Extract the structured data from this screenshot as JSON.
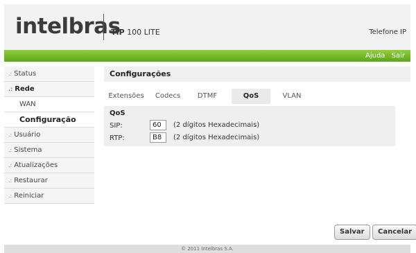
{
  "header": {
    "logo": "intelbras",
    "product_bold": "TIP",
    "product_rest": " 100 LITE",
    "right_label": "Telefone IP"
  },
  "top_links": [
    "Ajuda",
    "Sair"
  ],
  "sidebar": {
    "items": [
      {
        "label": "Status"
      },
      {
        "label": "Rede"
      },
      {
        "label": "WAN"
      },
      {
        "label": "Configuração"
      },
      {
        "label": "Usuário"
      },
      {
        "label": "Sistema"
      },
      {
        "label": "Atualizações"
      },
      {
        "label": "Restaurar"
      },
      {
        "label": "Reiniciar"
      }
    ],
    "bullet": ".:"
  },
  "content": {
    "title": "Configurações",
    "tabs": [
      "Extensões",
      "Codecs",
      "DTMF",
      "QoS",
      "VLAN"
    ],
    "active_tab": "QoS",
    "panel": {
      "title": "QoS",
      "sip_label": "SIP:",
      "sip_value": "60",
      "sip_hint": "(2 dígitos Hexadecimais)",
      "rtp_label": "RTP:",
      "rtp_value": "B8",
      "rtp_hint": "(2 dígitos Hexadecimais)"
    }
  },
  "buttons": {
    "save": "Salvar",
    "cancel": "Cancelar"
  },
  "footer": "© 2011 Intelbras S.A.",
  "colors": {
    "accent_green": "#5ea61d",
    "header_bg": "#f2f2f2"
  }
}
